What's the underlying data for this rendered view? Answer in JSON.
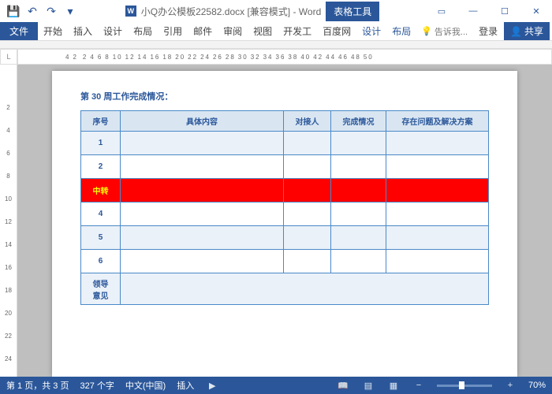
{
  "titlebar": {
    "doc_title": "小Q办公模板22582.docx [兼容模式] - Word",
    "table_tools": "表格工具"
  },
  "tabs": {
    "file": "文件",
    "items": [
      "开始",
      "插入",
      "设计",
      "布局",
      "引用",
      "邮件",
      "审阅",
      "视图",
      "开发工",
      "百度网"
    ],
    "ctx": [
      "设计",
      "布局"
    ],
    "tell_me": "告诉我...",
    "login": "登录",
    "share": "共享"
  },
  "ruler": {
    "h": [
      "4",
      "2",
      "",
      "2",
      "4",
      "6",
      "8",
      "10",
      "12",
      "14",
      "16",
      "18",
      "20",
      "22",
      "24",
      "26",
      "28",
      "30",
      "32",
      "34",
      "36",
      "38",
      "40",
      "42",
      "44",
      "46",
      "48",
      "50"
    ],
    "v": [
      "2",
      "4",
      "6",
      "8",
      "10",
      "12",
      "14",
      "16",
      "18",
      "20",
      "22",
      "24"
    ]
  },
  "document": {
    "heading": "第 30 周工作完成情况：",
    "headers": [
      "序号",
      "具体内容",
      "对接人",
      "完成情况",
      "存在问题及解决方案"
    ],
    "rows": [
      {
        "n": "1",
        "alt": true
      },
      {
        "n": "2",
        "alt": false
      },
      {
        "n": "中转",
        "red": true
      },
      {
        "n": "4",
        "alt": false
      },
      {
        "n": "5",
        "alt": true
      },
      {
        "n": "6",
        "alt": false
      }
    ],
    "footer_row": "领导\n意见"
  },
  "status": {
    "page": "第 1 页，共 3 页",
    "words": "327 个字",
    "lang": "中文(中国)",
    "mode": "插入",
    "zoom": "70%"
  }
}
